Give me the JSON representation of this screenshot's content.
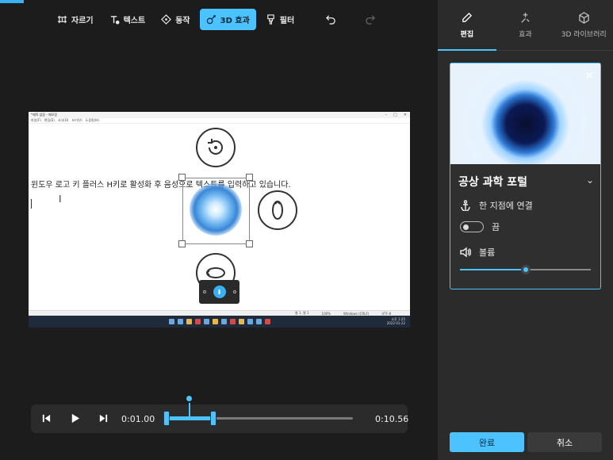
{
  "toolbar": {
    "items": [
      {
        "label": "자르기",
        "icon": "trim-icon"
      },
      {
        "label": "텍스트",
        "icon": "text-icon"
      },
      {
        "label": "동작",
        "icon": "motion-icon"
      },
      {
        "label": "3D 효과",
        "icon": "3d-effects-icon",
        "active": true
      },
      {
        "label": "필터",
        "icon": "filter-icon"
      }
    ],
    "undo_icon": "undo-icon",
    "redo_icon": "redo-icon"
  },
  "preview": {
    "window_title": "*제목 없음 - 메모장",
    "menu": [
      "파일(F)",
      "편집(E)",
      "서식(O)",
      "보기(V)",
      "도움말(H)"
    ],
    "body_text": "윈도우 로고 키 플러스 H키로 활성화 후 음성으로 텍스트를 입력하고 있습니다.",
    "status": [
      "줄 1, 열 1",
      "100%",
      "Windows (CRLF)",
      "UTF-8"
    ],
    "tray_time": "오후 1:25",
    "tray_date": "2022-01-22"
  },
  "playback": {
    "current_time": "0:01.00",
    "total_time": "0:10.56"
  },
  "panel": {
    "tabs": [
      {
        "label": "편집",
        "icon": "pencil-icon",
        "active": true
      },
      {
        "label": "효과",
        "icon": "sparkle-icon"
      },
      {
        "label": "3D 라이브러리",
        "icon": "cube-icon"
      }
    ],
    "effect_title": "공상 과학 포털",
    "anchor_label": "한 지점에 연결",
    "toggle_label": "끔",
    "volume_label": "볼륨",
    "volume_level": 0.5,
    "done_label": "완료",
    "cancel_label": "취소"
  },
  "colors": {
    "accent": "#4cc2ff",
    "background": "#1c1c1c",
    "panel": "#2b2b2b"
  }
}
